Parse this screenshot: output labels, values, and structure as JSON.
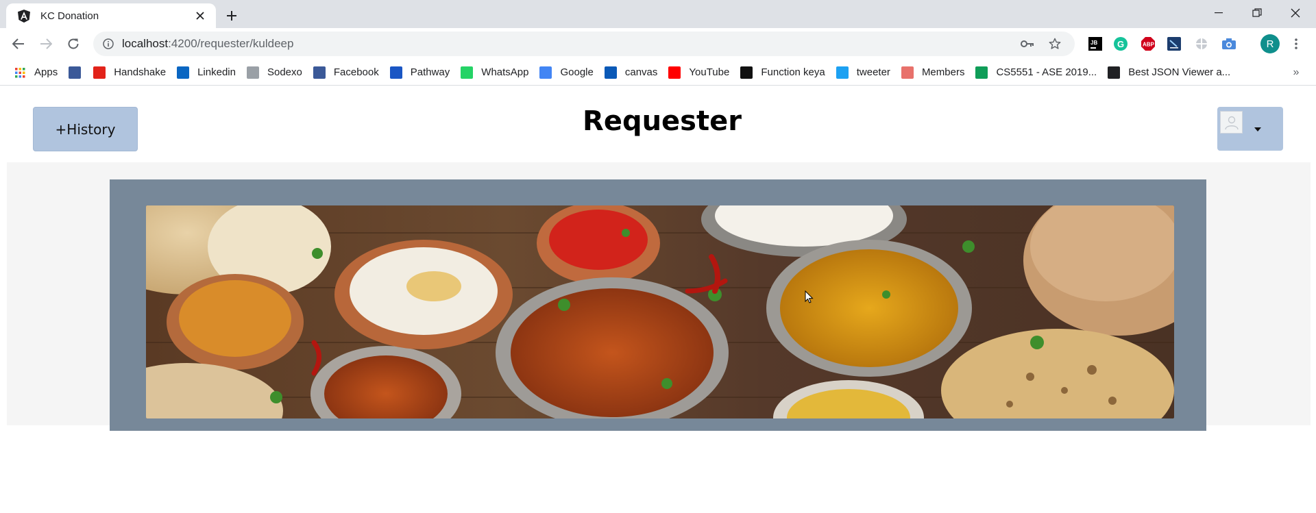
{
  "browser": {
    "tab_title": "KC Donation",
    "url_host": "localhost",
    "url_path": ":4200/requester/kuldeep",
    "profile_initial": "R"
  },
  "bookmarks": [
    {
      "label": "Apps",
      "icon": "apps-grid-icon",
      "color": "#ea4335"
    },
    {
      "label": "",
      "icon": "facebook-icon",
      "color": "#3b5998"
    },
    {
      "label": "Handshake",
      "icon": "handshake-icon",
      "color": "#e2231a"
    },
    {
      "label": "Linkedin",
      "icon": "linkedin-icon",
      "color": "#0a66c2"
    },
    {
      "label": "Sodexo",
      "icon": "sodexo-icon",
      "color": "#9aa0a6"
    },
    {
      "label": "Facebook",
      "icon": "facebook-icon",
      "color": "#3b5998"
    },
    {
      "label": "Pathway",
      "icon": "pathway-icon",
      "color": "#1a56c4"
    },
    {
      "label": "WhatsApp",
      "icon": "whatsapp-icon",
      "color": "#25d366"
    },
    {
      "label": "Google",
      "icon": "google-icon",
      "color": "#4285f4"
    },
    {
      "label": "canvas",
      "icon": "umkc-icon",
      "color": "#0a59b7"
    },
    {
      "label": "YouTube",
      "icon": "youtube-icon",
      "color": "#ff0000"
    },
    {
      "label": "Function keya",
      "icon": "htg-icon",
      "color": "#111111"
    },
    {
      "label": "tweeter",
      "icon": "twitter-icon",
      "color": "#1da1f2"
    },
    {
      "label": "Members",
      "icon": "members-icon",
      "color": "#e8716b"
    },
    {
      "label": "CS5551 - ASE 2019...",
      "icon": "google-drive-icon",
      "color": "#0f9d58"
    },
    {
      "label": "Best JSON Viewer a...",
      "icon": "codebeautify-icon",
      "color": "#202124"
    }
  ],
  "page": {
    "history_button": "+History",
    "title": "Requester"
  },
  "colors": {
    "button_bg": "#b0c4de",
    "frame": "#778899",
    "band": "#f5f5f5"
  }
}
